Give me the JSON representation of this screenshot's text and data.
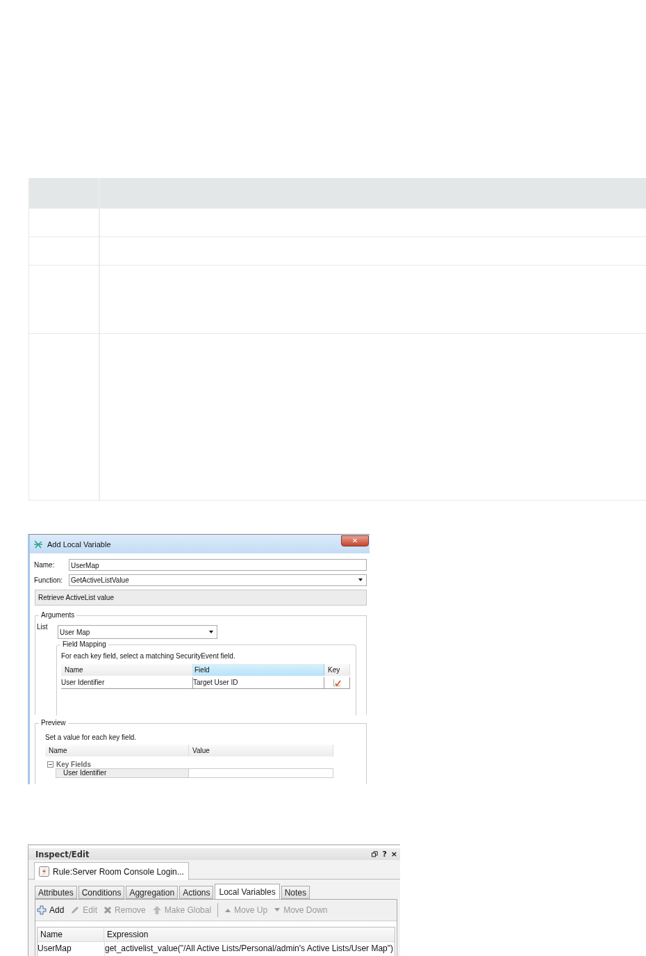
{
  "dialog": {
    "title": "Add Local Variable",
    "close_label": "✕",
    "name_field": {
      "label": "Name:",
      "value": "UserMap"
    },
    "function_field": {
      "label": "Function:",
      "value": "GetActiveListValue"
    },
    "description": "Retrieve ActiveList value",
    "arguments": {
      "legend": "Arguments",
      "list_label": "List",
      "list_value": "User Map",
      "field_mapping": {
        "legend": "Field Mapping",
        "hint": "For each key field, select a matching SecurityEvent field.",
        "columns": [
          {
            "label": "Name",
            "selected": false
          },
          {
            "label": "Field",
            "selected": true
          },
          {
            "label": "Key",
            "selected": false
          }
        ],
        "rows": [
          {
            "name": "User Identifier",
            "field": "Target User ID",
            "key": true
          }
        ]
      }
    },
    "preview": {
      "legend": "Preview",
      "hint": "Set a value for each key field.",
      "columns": [
        "Name",
        "Value"
      ],
      "groups": [
        {
          "label": "Key Fields",
          "expanded": true,
          "rows": [
            {
              "name": "User Identifier"
            }
          ]
        }
      ]
    }
  },
  "inspector": {
    "title": "Inspect/Edit",
    "window_buttons": [
      "?",
      "×"
    ],
    "document_tab": "Rule:Server Room Console Login...",
    "tabs": [
      {
        "label": "Attributes",
        "selected": false
      },
      {
        "label": "Conditions",
        "selected": false
      },
      {
        "label": "Aggregation",
        "selected": false
      },
      {
        "label": "Actions",
        "selected": false
      },
      {
        "label": "Local Variables",
        "selected": true
      },
      {
        "label": "Notes",
        "selected": false
      }
    ],
    "toolbar": [
      {
        "kind": "add",
        "label": "Add",
        "disabled": false
      },
      {
        "kind": "edit",
        "label": "Edit",
        "disabled": true
      },
      {
        "kind": "remove",
        "label": "Remove",
        "disabled": true
      },
      {
        "kind": "global",
        "label": "Make Global",
        "disabled": true
      },
      {
        "kind": "up",
        "label": "Move Up",
        "disabled": true,
        "separator_before": true
      },
      {
        "kind": "down",
        "label": "Move Down",
        "disabled": true
      }
    ],
    "columns": [
      "Name",
      "Expression"
    ],
    "rows": [
      {
        "name": "UserMap",
        "expression": "get_activelist_value(\"/All Active Lists/Personal/admin's Active Lists/User Map\")"
      }
    ]
  }
}
